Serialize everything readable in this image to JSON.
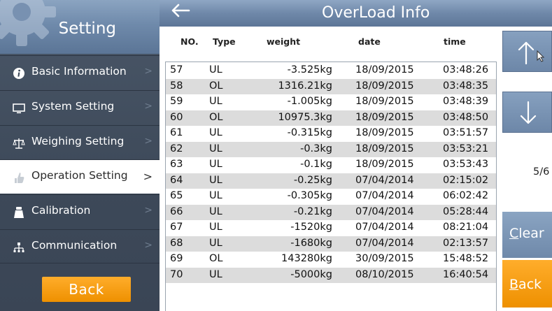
{
  "colors": {
    "header_blue": "#6f88a9",
    "sidebar_dark": "#3d4959",
    "accent_orange": "#f59a0c",
    "row_alt": "#dcdcdc"
  },
  "sidebar": {
    "title": "Setting",
    "header_icon": "gear-icon",
    "items": [
      {
        "label": "Basic Information",
        "icon": "info-icon"
      },
      {
        "label": "System Setting",
        "icon": "monitor-icon"
      },
      {
        "label": "Weighing Setting",
        "icon": "scale-icon"
      },
      {
        "label": "Operation Setting",
        "icon": "hand-icon",
        "chevron": ">"
      },
      {
        "label": "Calibration",
        "icon": "weight-icon"
      },
      {
        "label": "Communication",
        "icon": "network-icon"
      }
    ],
    "chevron": ">",
    "back_label": "Back"
  },
  "topbar": {
    "back_icon": "left-arrow-icon",
    "title": "OverLoad Info"
  },
  "table": {
    "columns": [
      "NO.",
      "Type",
      "weight",
      "date",
      "time"
    ],
    "rows": [
      {
        "no": "57",
        "type": "UL",
        "weight": "-3.525kg",
        "date": "18/09/2015",
        "time": "03:48:26"
      },
      {
        "no": "58",
        "type": "OL",
        "weight": "1316.21kg",
        "date": "18/09/2015",
        "time": "03:48:35"
      },
      {
        "no": "59",
        "type": "UL",
        "weight": "-1.005kg",
        "date": "18/09/2015",
        "time": "03:48:39"
      },
      {
        "no": "60",
        "type": "OL",
        "weight": "10975.3kg",
        "date": "18/09/2015",
        "time": "03:48:50"
      },
      {
        "no": "61",
        "type": "UL",
        "weight": "-0.315kg",
        "date": "18/09/2015",
        "time": "03:51:57"
      },
      {
        "no": "62",
        "type": "UL",
        "weight": "-0.3kg",
        "date": "18/09/2015",
        "time": "03:53:21"
      },
      {
        "no": "63",
        "type": "UL",
        "weight": "-0.1kg",
        "date": "18/09/2015",
        "time": "03:53:43"
      },
      {
        "no": "64",
        "type": "UL",
        "weight": "-0.25kg",
        "date": "07/04/2014",
        "time": "02:15:02"
      },
      {
        "no": "65",
        "type": "UL",
        "weight": "-0.305kg",
        "date": "07/04/2014",
        "time": "06:02:42"
      },
      {
        "no": "66",
        "type": "UL",
        "weight": "-0.21kg",
        "date": "07/04/2014",
        "time": "05:28:44"
      },
      {
        "no": "67",
        "type": "UL",
        "weight": "-1520kg",
        "date": "07/04/2014",
        "time": "08:21:04"
      },
      {
        "no": "68",
        "type": "UL",
        "weight": "-1680kg",
        "date": "07/04/2014",
        "time": "02:13:57"
      },
      {
        "no": "69",
        "type": "OL",
        "weight": "143280kg",
        "date": "30/09/2015",
        "time": "15:48:52"
      },
      {
        "no": "70",
        "type": "UL",
        "weight": "-5000kg",
        "date": "08/10/2015",
        "time": "16:40:54"
      }
    ]
  },
  "controls": {
    "up_icon": "up-arrow-icon",
    "down_icon": "down-arrow-icon",
    "page": "5/6",
    "clear_first": "C",
    "clear_rest": "lear",
    "back_first": "B",
    "back_rest": "ack"
  }
}
